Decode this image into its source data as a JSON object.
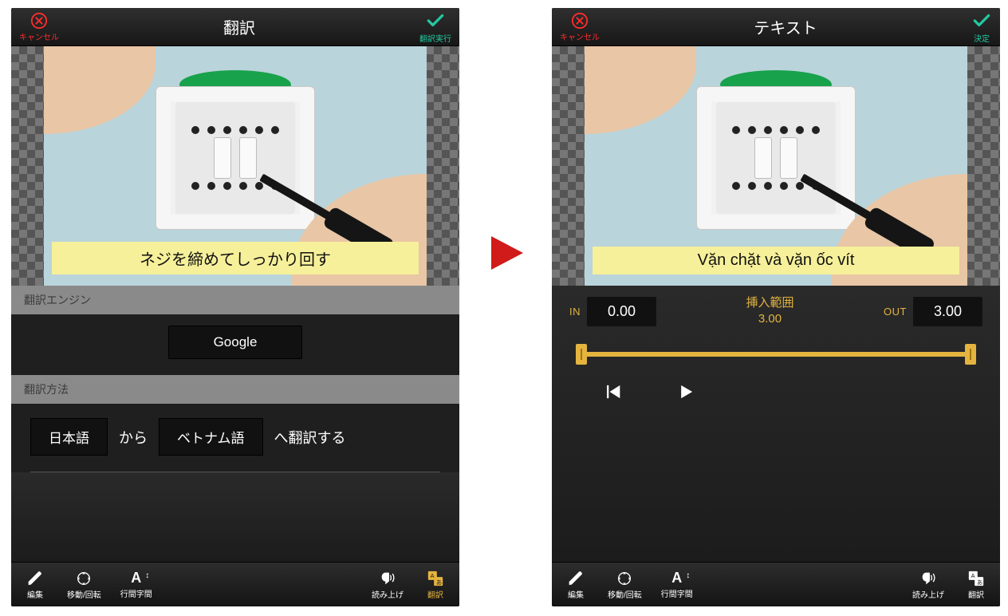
{
  "arrow_color": "#d11a1a",
  "colors": {
    "accent": "#e4b43f",
    "teal": "#23c8a0",
    "red": "#ff2d2d"
  },
  "header": {
    "cancel_label": "キャンセル",
    "left_title": "翻訳",
    "right_title": "テキスト",
    "left_confirm": "翻訳実行",
    "right_confirm": "決定"
  },
  "captions": {
    "left": "ネジを締めてしっかり回す",
    "right": "Vặn chặt và vặn ốc vít"
  },
  "left_body": {
    "engine_label": "翻訳エンジン",
    "engine_value": "Google",
    "method_label": "翻訳方法",
    "from_lang": "日本語",
    "from_particle": "から",
    "to_lang": "ベトナム語",
    "to_particle": "へ翻訳する"
  },
  "right_body": {
    "in_label": "IN",
    "out_label": "OUT",
    "in_value": "0.00",
    "out_value": "3.00",
    "range_title": "挿入範囲",
    "range_value": "3.00"
  },
  "toolbar": {
    "edit": "編集",
    "move": "移動/回転",
    "kerning": "行間字間",
    "speak": "読み上げ",
    "translate": "翻訳"
  }
}
